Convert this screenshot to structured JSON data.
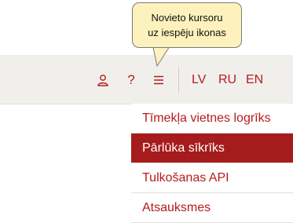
{
  "tooltip": {
    "line1": "Novieto kursoru",
    "line2": "uz iespēju ikonas"
  },
  "header": {
    "icons": [
      "user-icon",
      "help-icon",
      "menu-icon"
    ],
    "help_glyph": "?",
    "languages": [
      "LV",
      "RU",
      "EN"
    ]
  },
  "menu": {
    "items": [
      {
        "label": "Tīmekļa vietnes logrīks",
        "active": false
      },
      {
        "label": "Pārlūka sīkrīks",
        "active": true
      },
      {
        "label": "Tulkošanas API",
        "active": false
      },
      {
        "label": "Atsauksmes",
        "active": false
      }
    ]
  },
  "colors": {
    "accent": "#b51c1c",
    "active_bg": "#a61b1b",
    "bar_bg": "#f1efeb",
    "tooltip_bg": "#fdf2bd"
  }
}
